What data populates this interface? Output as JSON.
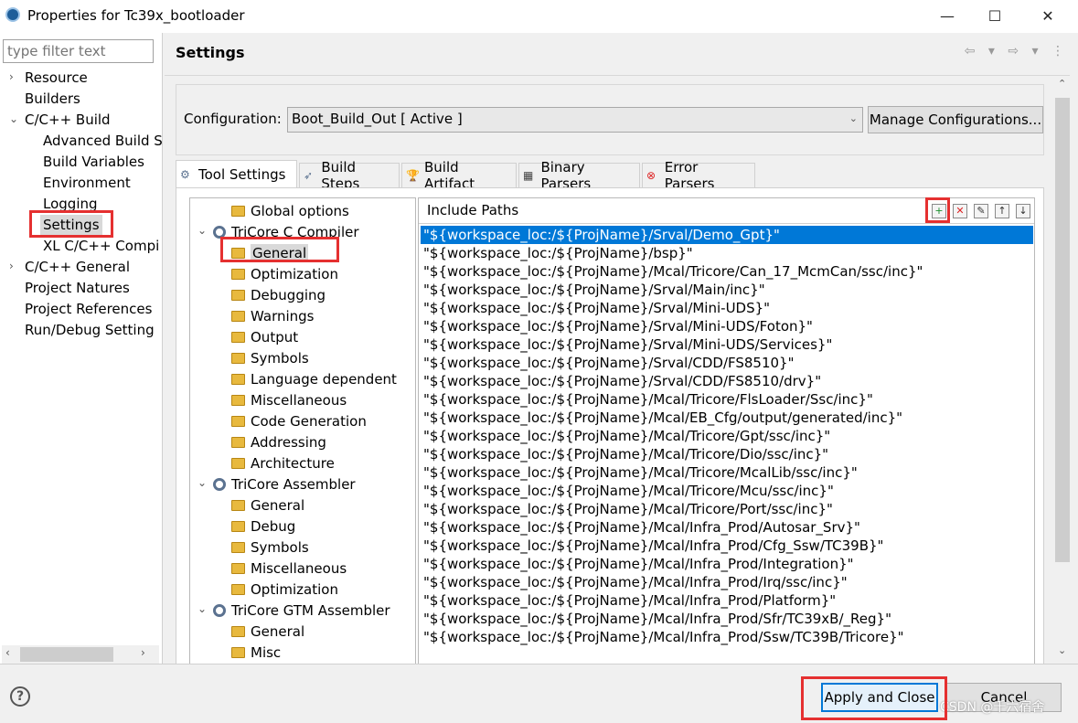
{
  "window": {
    "title": "Properties for Tc39x_bootloader",
    "minimize": "—",
    "maximize": "☐",
    "close": "✕"
  },
  "filter_placeholder": "type filter text",
  "nav": [
    {
      "label": "Resource",
      "caret": "›"
    },
    {
      "label": "Builders",
      "caret": ""
    },
    {
      "label": "C/C++ Build",
      "caret": "⌄"
    },
    {
      "label": "Advanced Build S",
      "caret": ""
    },
    {
      "label": "Build Variables",
      "caret": ""
    },
    {
      "label": "Environment",
      "caret": ""
    },
    {
      "label": "Logging",
      "caret": ""
    },
    {
      "label": "Settings",
      "caret": "",
      "selected": true
    },
    {
      "label": "XL C/C++ Compi",
      "caret": ""
    },
    {
      "label": "C/C++ General",
      "caret": "›"
    },
    {
      "label": "Project Natures",
      "caret": ""
    },
    {
      "label": "Project References",
      "caret": ""
    },
    {
      "label": "Run/Debug Setting",
      "caret": ""
    }
  ],
  "header": {
    "title": "Settings",
    "arrows": "⇦ ▾ ⇨ ▾ ⋮"
  },
  "configuration": {
    "label": "Configuration:",
    "value": "Boot_Build_Out  [ Active ]",
    "manage_label": "Manage Configurations..."
  },
  "tabs": [
    {
      "label": "Tool Settings",
      "icon": "tool-settings-icon",
      "active": true
    },
    {
      "label": "Build Steps",
      "icon": "build-steps-icon"
    },
    {
      "label": "Build Artifact",
      "icon": "build-artifact-icon"
    },
    {
      "label": "Binary Parsers",
      "icon": "binary-parsers-icon"
    },
    {
      "label": "Error Parsers",
      "icon": "error-parsers-icon"
    }
  ],
  "tree": [
    {
      "label": "Global options",
      "level": 1,
      "icon": "folder"
    },
    {
      "label": "TriCore C Compiler",
      "level": 0,
      "icon": "cog",
      "caret": "⌄"
    },
    {
      "label": "General",
      "level": 1,
      "icon": "folder",
      "selected": true
    },
    {
      "label": "Optimization",
      "level": 1,
      "icon": "folder"
    },
    {
      "label": "Debugging",
      "level": 1,
      "icon": "folder"
    },
    {
      "label": "Warnings",
      "level": 1,
      "icon": "folder"
    },
    {
      "label": "Output",
      "level": 1,
      "icon": "folder"
    },
    {
      "label": "Symbols",
      "level": 1,
      "icon": "folder"
    },
    {
      "label": "Language dependent",
      "level": 1,
      "icon": "folder"
    },
    {
      "label": "Miscellaneous",
      "level": 1,
      "icon": "folder"
    },
    {
      "label": "Code Generation",
      "level": 1,
      "icon": "folder"
    },
    {
      "label": "Addressing",
      "level": 1,
      "icon": "folder"
    },
    {
      "label": "Architecture",
      "level": 1,
      "icon": "folder"
    },
    {
      "label": "TriCore Assembler",
      "level": 0,
      "icon": "cog",
      "caret": "⌄"
    },
    {
      "label": "General",
      "level": 1,
      "icon": "folder"
    },
    {
      "label": "Debug",
      "level": 1,
      "icon": "folder"
    },
    {
      "label": "Symbols",
      "level": 1,
      "icon": "folder"
    },
    {
      "label": "Miscellaneous",
      "level": 1,
      "icon": "folder"
    },
    {
      "label": "Optimization",
      "level": 1,
      "icon": "folder"
    },
    {
      "label": "TriCore GTM Assembler",
      "level": 0,
      "icon": "cog",
      "caret": "⌄"
    },
    {
      "label": "General",
      "level": 1,
      "icon": "folder"
    },
    {
      "label": "Misc",
      "level": 1,
      "icon": "folder"
    }
  ],
  "include_paths": {
    "title": "Include Paths",
    "toolbar": [
      "add-icon",
      "delete-icon",
      "edit-icon",
      "move-up-icon",
      "move-down-icon"
    ],
    "items": [
      "\"${workspace_loc:/${ProjName}/Srval/Demo_Gpt}\"",
      "\"${workspace_loc:/${ProjName}/bsp}\"",
      "\"${workspace_loc:/${ProjName}/Mcal/Tricore/Can_17_McmCan/ssc/inc}\"",
      "\"${workspace_loc:/${ProjName}/Srval/Main/inc}\"",
      "\"${workspace_loc:/${ProjName}/Srval/Mini-UDS}\"",
      "\"${workspace_loc:/${ProjName}/Srval/Mini-UDS/Foton}\"",
      "\"${workspace_loc:/${ProjName}/Srval/Mini-UDS/Services}\"",
      "\"${workspace_loc:/${ProjName}/Srval/CDD/FS8510}\"",
      "\"${workspace_loc:/${ProjName}/Srval/CDD/FS8510/drv}\"",
      "\"${workspace_loc:/${ProjName}/Mcal/Tricore/FlsLoader/Ssc/inc}\"",
      "\"${workspace_loc:/${ProjName}/Mcal/EB_Cfg/output/generated/inc}\"",
      "\"${workspace_loc:/${ProjName}/Mcal/Tricore/Gpt/ssc/inc}\"",
      "\"${workspace_loc:/${ProjName}/Mcal/Tricore/Dio/ssc/inc}\"",
      "\"${workspace_loc:/${ProjName}/Mcal/Tricore/McalLib/ssc/inc}\"",
      "\"${workspace_loc:/${ProjName}/Mcal/Tricore/Mcu/ssc/inc}\"",
      "\"${workspace_loc:/${ProjName}/Mcal/Tricore/Port/ssc/inc}\"",
      "\"${workspace_loc:/${ProjName}/Mcal/Infra_Prod/Autosar_Srv}\"",
      "\"${workspace_loc:/${ProjName}/Mcal/Infra_Prod/Cfg_Ssw/TC39B}\"",
      "\"${workspace_loc:/${ProjName}/Mcal/Infra_Prod/Integration}\"",
      "\"${workspace_loc:/${ProjName}/Mcal/Infra_Prod/Irq/ssc/inc}\"",
      "\"${workspace_loc:/${ProjName}/Mcal/Infra_Prod/Platform}\"",
      "\"${workspace_loc:/${ProjName}/Mcal/Infra_Prod/Sfr/TC39xB/_Reg}\"",
      "\"${workspace_loc:/${ProjName}/Mcal/Infra_Prod/Ssw/TC39B/Tricore}\""
    ]
  },
  "bottom": {
    "help": "?",
    "apply_close": "Apply and Close",
    "cancel": "Cancel"
  },
  "watermark": "CSDN @千六宿舍",
  "colors": {
    "selection": "#0078d7",
    "highlight_box": "#e53030"
  }
}
